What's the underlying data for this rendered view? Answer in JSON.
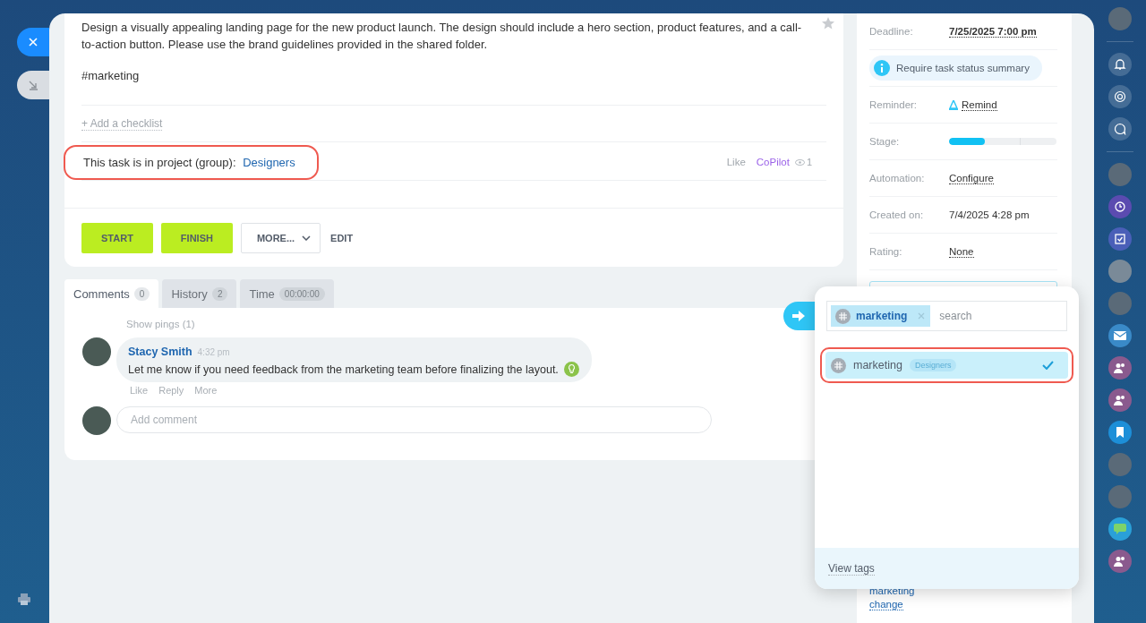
{
  "task": {
    "description": "Design a visually appealing landing page for the new product launch. The design should include a hero section, product features, and a call-to-action button. Please use the brand guidelines provided in the shared folder.",
    "tag": "#marketing",
    "starred": false,
    "add_checklist": "+ Add a checklist",
    "project_label": "This task is in project (group):",
    "project": "Designers",
    "project_highlighted": true,
    "like": "Like",
    "copilot": "CoPilot",
    "views": "1",
    "buttons": [
      {
        "label": "START",
        "kind": "primary"
      },
      {
        "label": "FINISH",
        "kind": "primary"
      },
      {
        "label": "MORE...",
        "kind": "dropdown"
      },
      {
        "label": "EDIT",
        "kind": "link"
      }
    ]
  },
  "tabs": [
    {
      "label": "Comments",
      "count": "0",
      "selected": true
    },
    {
      "label": "History",
      "count": "2",
      "selected": false
    },
    {
      "label": "Time",
      "count": "00:00:00",
      "selected": false
    }
  ],
  "show_pings": "Show pings (1)",
  "comments": [
    {
      "author": "Stacy Smith",
      "time": "4:32 pm",
      "text": "Let me know if you need feedback from the marketing team before finalizing the layout.",
      "actions": [
        "Like",
        "Reply",
        "More"
      ]
    }
  ],
  "comment_field": {
    "placeholder": "Add comment"
  },
  "sidebar": {
    "fields": [
      {
        "kind": "date",
        "label": "Deadline:",
        "value": "7/25/2025 7:00 pm"
      },
      {
        "kind": "notice",
        "value": "Require task status summary"
      },
      {
        "kind": "reminder",
        "label": "Reminder:",
        "value": "Remind"
      },
      {
        "kind": "stage",
        "label": "Stage:",
        "level": 0.33
      },
      {
        "kind": "link",
        "label": "Automation:",
        "value": "Configure"
      },
      {
        "kind": "text",
        "label": "Created on:",
        "value": "7/4/2025 4:28 pm"
      },
      {
        "kind": "link",
        "label": "Rating:",
        "value": "None"
      }
    ],
    "tags": [
      "marketing"
    ],
    "change": "change"
  },
  "tag_popup": {
    "chips": [
      "marketing"
    ],
    "search_placeholder": "search",
    "options": [
      {
        "tag": "marketing",
        "project": "Designers",
        "selected": true,
        "highlighted": true
      }
    ],
    "footer": "View tags"
  }
}
